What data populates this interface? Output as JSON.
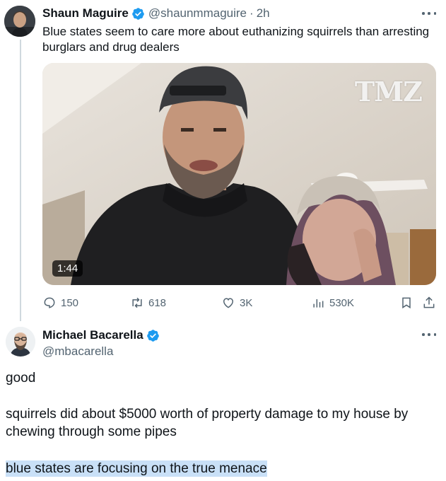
{
  "tweet1": {
    "author_name": "Shaun Maguire",
    "handle": "@shaunmmaguire",
    "separator": "·",
    "time": "2h",
    "text": "Blue states seem to care more about euthanizing squirrels than arresting burglars and drug dealers",
    "video": {
      "duration": "1:44",
      "watermark": "TMZ"
    },
    "stats": {
      "replies": "150",
      "retweets": "618",
      "likes": "3K",
      "views": "530K"
    }
  },
  "tweet2": {
    "author_name": "Michael Bacarella",
    "handle": "@mbacarella",
    "paragraphs": [
      "good",
      "squirrels did about $5000 worth of property damage to my house by chewing through some pipes",
      "blue states are focusing on the true menace"
    ]
  },
  "colors": {
    "verified_blue": "#1d9bf0",
    "text_primary": "#0f1419",
    "text_secondary": "#536471",
    "thread_line": "#cfd9de",
    "selection_highlight": "#c9e0f7"
  },
  "icons": [
    "verified-badge-icon",
    "more-icon",
    "reply-icon",
    "retweet-icon",
    "like-icon",
    "views-icon",
    "bookmark-icon",
    "share-icon"
  ]
}
